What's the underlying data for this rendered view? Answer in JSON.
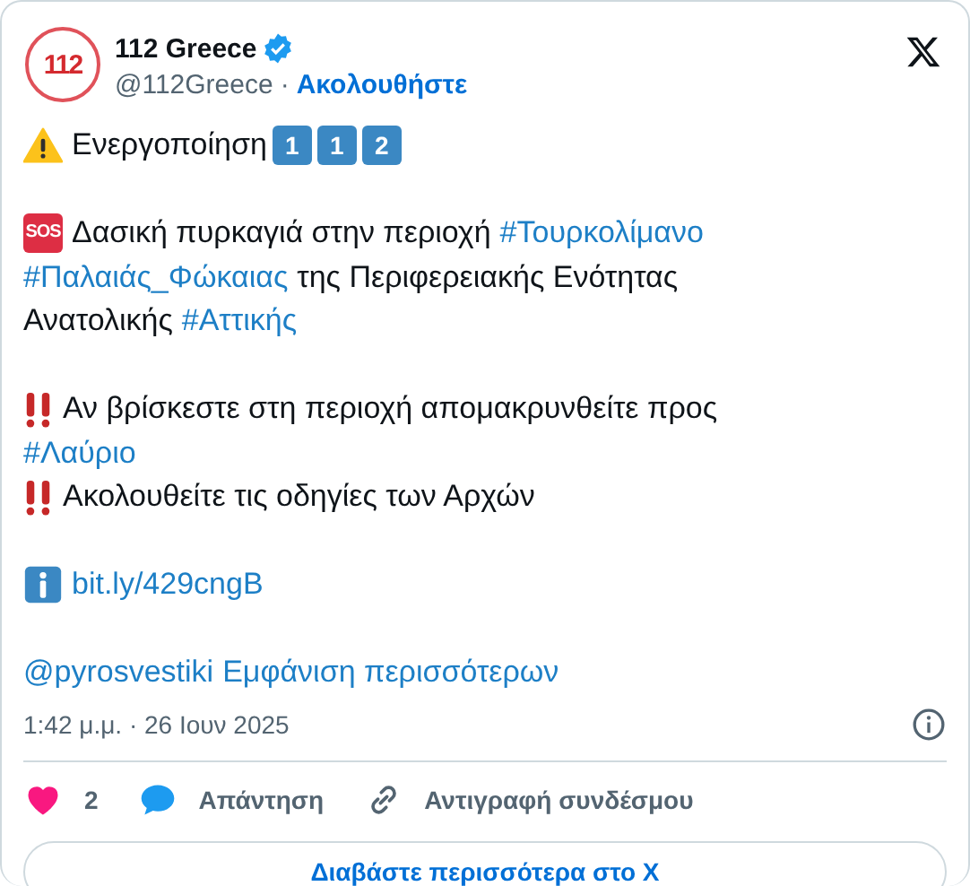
{
  "author": {
    "name": "112 Greece",
    "verified": true,
    "handle": "@112Greece",
    "separator": "·",
    "follow": "Ακολουθήστε",
    "avatar_text": "112"
  },
  "paragraphs": [
    [
      [
        {
          "kind": "warning"
        },
        {
          "kind": "text",
          "text": "Ενεργοποίηση"
        },
        {
          "kind": "keycap",
          "text": "1"
        },
        {
          "kind": "keycap",
          "text": "1"
        },
        {
          "kind": "keycap",
          "text": "2"
        }
      ]
    ],
    [
      [
        {
          "kind": "sos",
          "text": "SOS"
        },
        {
          "kind": "text",
          "text": "Δασική πυρκαγιά στην περιοχή"
        },
        {
          "kind": "tag",
          "text": "#Τουρκολίμανο"
        }
      ],
      [
        {
          "kind": "tag",
          "text": "#Παλαιάς_Φώκαιας"
        },
        {
          "kind": "text",
          "text": "της Περιφερειακής Ενότητας"
        }
      ],
      [
        {
          "kind": "text",
          "text": "Ανατολικής"
        },
        {
          "kind": "tag",
          "text": "#Αττικής"
        }
      ]
    ],
    [
      [
        {
          "kind": "bangbang"
        },
        {
          "kind": "text",
          "text": "Αν βρίσκεστε στη περιοχή απομακρυνθείτε προς"
        }
      ],
      [
        {
          "kind": "tag",
          "text": "#Λαύριο"
        }
      ],
      [
        {
          "kind": "bangbang"
        },
        {
          "kind": "text",
          "text": "Ακολουθείτε τις οδηγίες των Αρχών"
        }
      ]
    ],
    [
      [
        {
          "kind": "info"
        },
        {
          "kind": "tag",
          "text": "bit.ly/429cngB"
        }
      ]
    ],
    [
      [
        {
          "kind": "tag",
          "text": "@pyrosvestiki"
        },
        {
          "kind": "tag",
          "text": "Εμφάνιση περισσότερων"
        }
      ]
    ]
  ],
  "timestamp": "1:42 μ.μ. · 26 Ιουν 2025",
  "actions": [
    {
      "kind": "like",
      "label": "2"
    },
    {
      "kind": "reply",
      "label": "Απάντηση"
    },
    {
      "kind": "copy",
      "label": "Αντιγραφή συνδέσμου"
    }
  ],
  "read_more": "Διαβάστε περισσότερα στο X"
}
